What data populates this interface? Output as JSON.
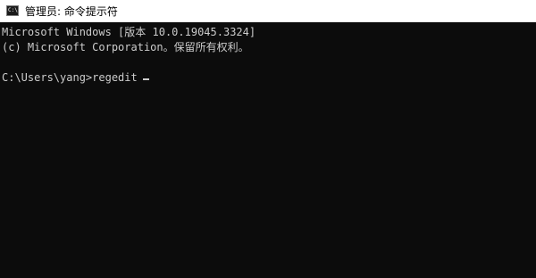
{
  "window": {
    "title": "管理员: 命令提示符",
    "icon": "cmd-console-icon",
    "icon_glyph": "C:\\"
  },
  "console": {
    "lines": [
      "Microsoft Windows [版本 10.0.19045.3324]",
      "(c) Microsoft Corporation。保留所有权利。",
      "",
      "C:\\Users\\yang>regedit"
    ]
  }
}
